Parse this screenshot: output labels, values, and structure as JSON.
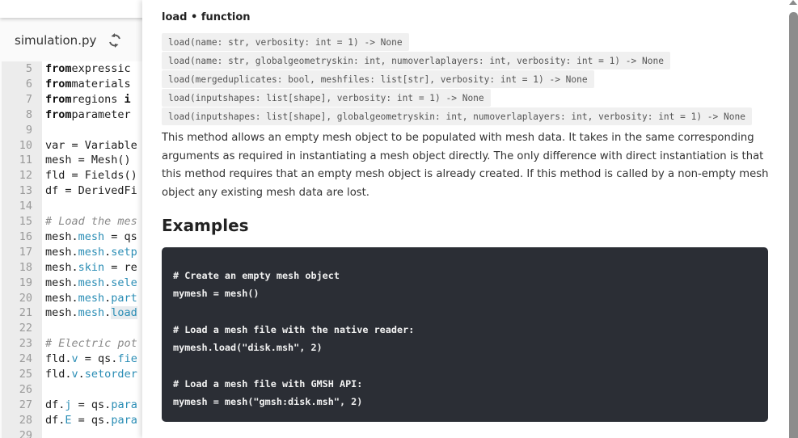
{
  "editor": {
    "file_name": "simulation.py",
    "sync_icon": "sync-icon",
    "lines": [
      {
        "n": "5",
        "parts": [
          [
            "kw",
            "from"
          ],
          [
            "",
            "expressic"
          ]
        ]
      },
      {
        "n": "6",
        "parts": [
          [
            "kw",
            "from"
          ],
          [
            "",
            "materials"
          ]
        ]
      },
      {
        "n": "7",
        "parts": [
          [
            "kw",
            "from"
          ],
          [
            "",
            "regions "
          ],
          [
            "kw",
            "i"
          ]
        ]
      },
      {
        "n": "8",
        "parts": [
          [
            "kw",
            "from"
          ],
          [
            "",
            "parameter"
          ]
        ]
      },
      {
        "n": "9",
        "parts": []
      },
      {
        "n": "10",
        "parts": [
          [
            "",
            "var = Variable"
          ]
        ]
      },
      {
        "n": "11",
        "parts": [
          [
            "",
            "mesh = Mesh()"
          ]
        ]
      },
      {
        "n": "12",
        "parts": [
          [
            "",
            "fld = Fields()"
          ]
        ]
      },
      {
        "n": "13",
        "parts": [
          [
            "",
            "df = DerivedFi"
          ]
        ]
      },
      {
        "n": "14",
        "parts": []
      },
      {
        "n": "15",
        "parts": [
          [
            "cm",
            "# Load the mes"
          ]
        ]
      },
      {
        "n": "16",
        "parts": [
          [
            "",
            "mesh."
          ],
          [
            "attr",
            "mesh"
          ],
          [
            "",
            " = qs"
          ]
        ]
      },
      {
        "n": "17",
        "parts": [
          [
            "",
            "mesh."
          ],
          [
            "attr",
            "mesh"
          ],
          [
            "",
            "."
          ],
          [
            "attr",
            "setp"
          ]
        ]
      },
      {
        "n": "18",
        "parts": [
          [
            "",
            "mesh."
          ],
          [
            "attr",
            "skin"
          ],
          [
            "",
            " = re"
          ]
        ]
      },
      {
        "n": "19",
        "parts": [
          [
            "",
            "mesh."
          ],
          [
            "attr",
            "mesh"
          ],
          [
            "",
            "."
          ],
          [
            "attr",
            "sele"
          ]
        ]
      },
      {
        "n": "20",
        "parts": [
          [
            "",
            "mesh."
          ],
          [
            "attr",
            "mesh"
          ],
          [
            "",
            "."
          ],
          [
            "attr",
            "part"
          ]
        ]
      },
      {
        "n": "21",
        "parts": [
          [
            "",
            "mesh."
          ],
          [
            "attr",
            "mesh"
          ],
          [
            "",
            "."
          ],
          [
            "attr hl",
            "load"
          ]
        ]
      },
      {
        "n": "22",
        "parts": []
      },
      {
        "n": "23",
        "parts": [
          [
            "cm",
            "# Electric pot"
          ]
        ]
      },
      {
        "n": "24",
        "parts": [
          [
            "",
            "fld."
          ],
          [
            "attr",
            "v"
          ],
          [
            "",
            " = qs."
          ],
          [
            "attr",
            "fie"
          ]
        ]
      },
      {
        "n": "25",
        "parts": [
          [
            "",
            "fld."
          ],
          [
            "attr",
            "v"
          ],
          [
            "",
            "."
          ],
          [
            "attr",
            "setorder"
          ]
        ]
      },
      {
        "n": "26",
        "parts": []
      },
      {
        "n": "27",
        "parts": [
          [
            "",
            "df."
          ],
          [
            "attr",
            "j"
          ],
          [
            "",
            " = qs."
          ],
          [
            "attr",
            "para"
          ]
        ]
      },
      {
        "n": "28",
        "parts": [
          [
            "",
            "df."
          ],
          [
            "attr",
            "E"
          ],
          [
            "",
            " = qs."
          ],
          [
            "attr",
            "para"
          ]
        ]
      },
      {
        "n": "29",
        "parts": []
      }
    ]
  },
  "doc": {
    "title": "load • function",
    "signatures": [
      "load(name: str, verbosity: int = 1) -> None",
      "load(name: str, globalgeometryskin: int, numoverlaplayers: int, verbosity: int = 1) -> None",
      "load(mergeduplicates: bool, meshfiles: list[str], verbosity: int = 1) -> None",
      "load(inputshapes: list[shape], verbosity: int = 1) -> None",
      "load(inputshapes: list[shape], globalgeometryskin: int, numoverlaplayers: int, verbosity: int = 1) -> None"
    ],
    "description": "This method allows an empty mesh object to be populated with mesh data. It takes in the same corresponding arguments as required in instantiating a mesh object directly. The only difference with direct instantiation is that this method requires that an empty mesh object is already created. If this method is called by a non-empty mesh object any existing mesh data are lost.",
    "examples_heading": "Examples",
    "example_code": "# Create an empty mesh object\nmymesh = mesh()\n\n# Load a mesh file with the native reader:\nmymesh.load(\"disk.msh\", 2)\n\n# Load a mesh file with GMSH API:\nmymesh = mesh(\"gmsh:disk.msh\", 2)"
  },
  "colors": {
    "attribute": "#2a8db5",
    "code_block_bg": "#2b2e35",
    "signature_bg": "#f0f0f0"
  }
}
